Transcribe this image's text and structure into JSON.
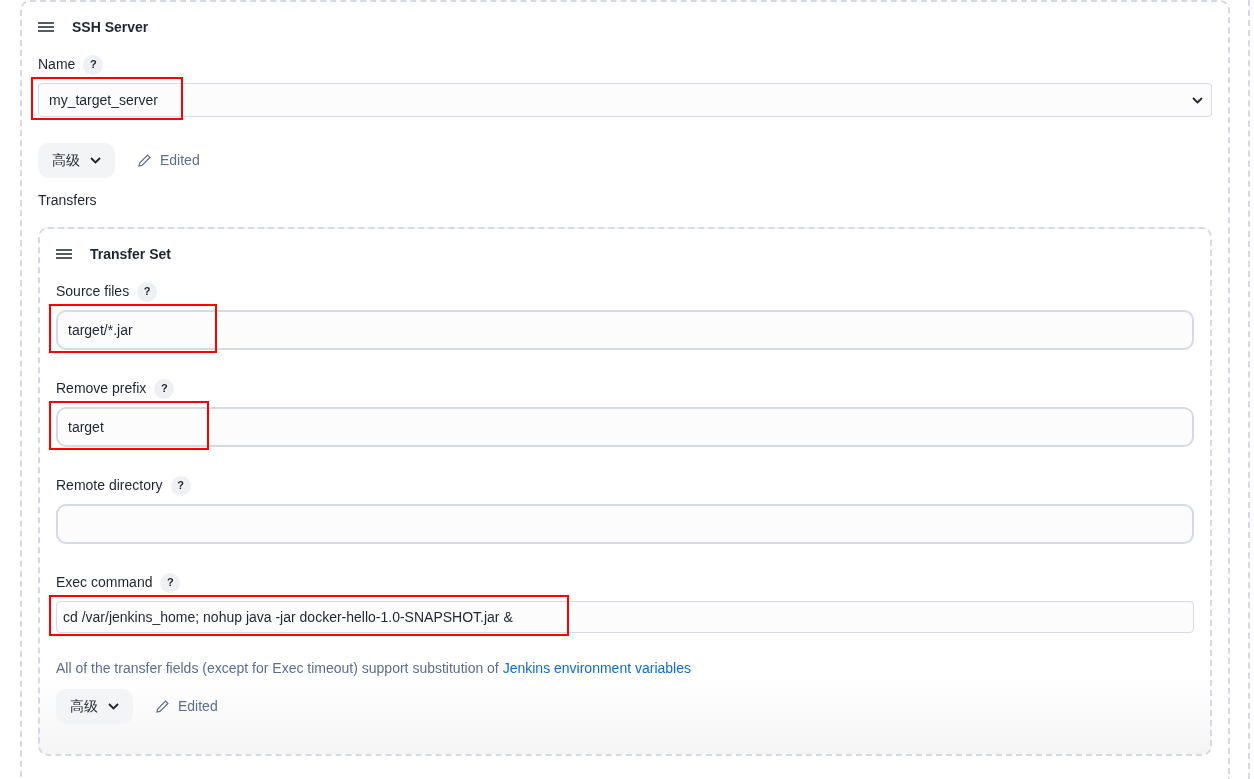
{
  "section": {
    "title": "SSH Server",
    "name_field": {
      "label": "Name",
      "help": "?",
      "value": "my_target_server",
      "highlighted": true
    },
    "advanced": {
      "label": "高级",
      "edited": "Edited"
    },
    "transfers_label": "Transfers",
    "transfer_set": {
      "title": "Transfer Set",
      "fields": [
        {
          "kind": "input",
          "label": "Source files",
          "help": "?",
          "value": "target/*.jar",
          "highlighted": true
        },
        {
          "kind": "input",
          "label": "Remove prefix",
          "help": "?",
          "value": "target",
          "highlighted": true
        },
        {
          "kind": "input",
          "label": "Remote directory",
          "help": "?",
          "highlighted": false
        },
        {
          "kind": "textarea",
          "label": "Exec command",
          "help": "?",
          "value": "cd /var/jenkins_home; nohup java -jar docker-hello-1.0-SNAPSHOT.jar &",
          "highlighted": true
        }
      ],
      "note": {
        "text": "All of the transfer fields (except for Exec timeout) support substitution of ",
        "link": "Jenkins environment variables"
      },
      "advanced": {
        "label": "高级",
        "edited": "Edited"
      }
    }
  }
}
